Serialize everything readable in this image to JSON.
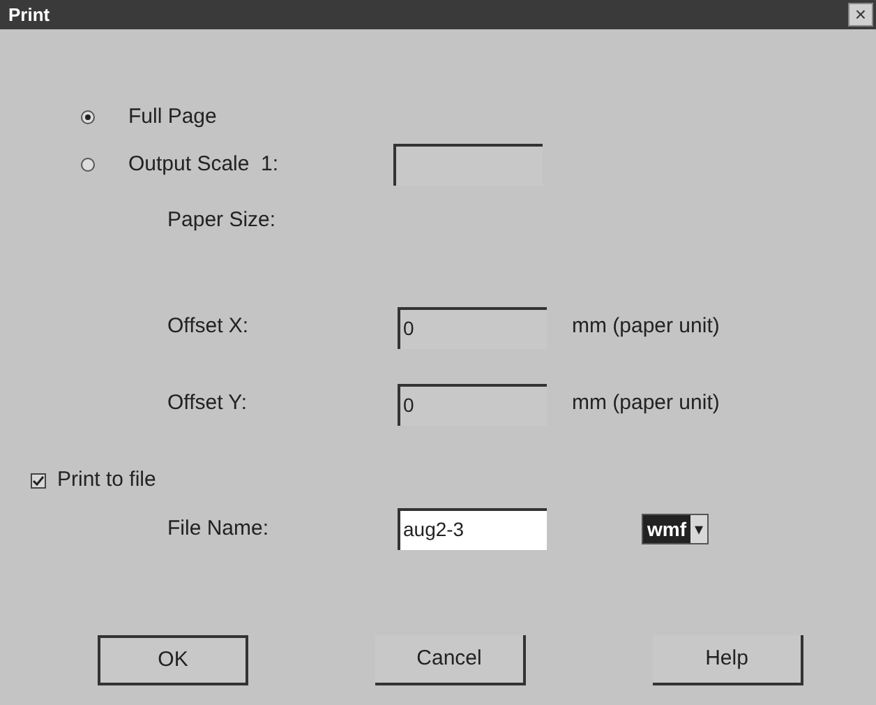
{
  "window": {
    "title": "Print",
    "close": "×"
  },
  "scale_options": [
    {
      "label": "Full Page",
      "selected": true
    },
    {
      "label": "Output Scale  1:",
      "selected": false
    }
  ],
  "paper_size": {
    "label": "Paper Size:"
  },
  "offsets": [
    {
      "label": "Offset X:",
      "value": "0",
      "unit": "mm (paper unit)"
    },
    {
      "label": "Offset Y:",
      "value": "0",
      "unit": "mm (paper unit)"
    }
  ],
  "print_to_file": {
    "label": "Print to file",
    "checked": true
  },
  "file_name": {
    "label": "File Name:",
    "value": "aug2-3"
  },
  "format": {
    "value": "wmf",
    "arrow": "▾"
  },
  "buttons": [
    {
      "label": "OK",
      "default": true
    },
    {
      "label": "Cancel",
      "default": false
    },
    {
      "label": "Help",
      "default": false
    }
  ]
}
